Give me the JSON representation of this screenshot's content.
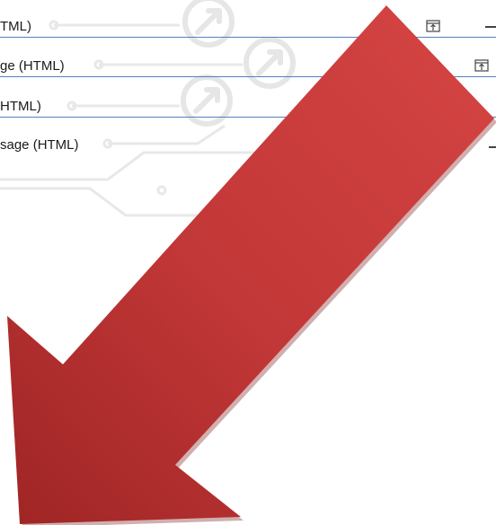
{
  "messages": [
    {
      "label": "TML)"
    },
    {
      "label": "ge (HTML)"
    },
    {
      "label": "HTML)"
    },
    {
      "label": "sage (HTML)"
    }
  ],
  "icons": {
    "attachment": "attachment-icon",
    "minimize": "dash-icon"
  },
  "colors": {
    "arrow_fill": "#c43a39",
    "arrow_shadow": "#8e1f1f",
    "row_rule": "#4f81bd",
    "watermark": "#e4e4e4"
  }
}
